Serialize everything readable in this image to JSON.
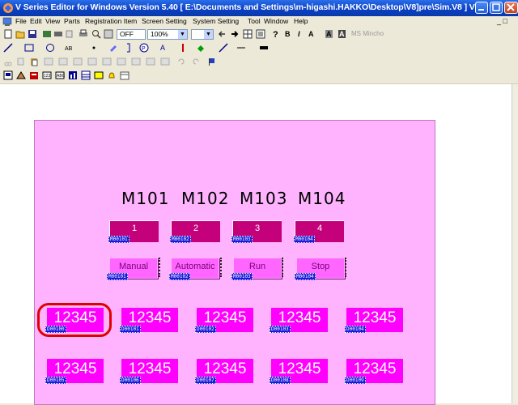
{
  "window": {
    "title": "V Series Editor for Windows Version 5.40 [ E:\\Documents and Settings\\m-higashi.HAKKO\\Desktop\\V8]pre\\Sim.V8 ] V8..."
  },
  "menu": {
    "items": [
      "File",
      "Edit",
      "View",
      "Parts",
      "Registration Item",
      "Screen Setting",
      "System Setting",
      "Tool",
      "Window",
      "Help"
    ]
  },
  "toolbar1": {
    "off_label": "OFF",
    "zoom": "100%",
    "font_name": "MS Mincho",
    "bold": "B",
    "italic": "I",
    "font_a": "A"
  },
  "screen": {
    "background": "#ffb3ff",
    "m_labels": [
      "M101",
      "M102",
      "M103",
      "M104"
    ],
    "lamps": [
      {
        "num": "1",
        "tag": "M00101"
      },
      {
        "num": "2",
        "tag": "M00102"
      },
      {
        "num": "3",
        "tag": "M00103"
      },
      {
        "num": "4",
        "tag": "M00104"
      }
    ],
    "switches": [
      {
        "label": "Manual",
        "tag": "M00101"
      },
      {
        "label": "Automatic",
        "tag": "M00102"
      },
      {
        "label": "Run",
        "tag": "M00103"
      },
      {
        "label": "Stop",
        "tag": "M00104"
      }
    ],
    "num_row1": [
      {
        "value": "12345",
        "tag": "D00100"
      },
      {
        "value": "12345",
        "tag": "D00101"
      },
      {
        "value": "12345",
        "tag": "D00102"
      },
      {
        "value": "12345",
        "tag": "D00103"
      },
      {
        "value": "12345",
        "tag": "D00104"
      }
    ],
    "num_row2": [
      {
        "value": "12345",
        "tag": "D00105"
      },
      {
        "value": "12345",
        "tag": "D00106"
      },
      {
        "value": "12345",
        "tag": "D00107"
      },
      {
        "value": "12345",
        "tag": "D00108"
      },
      {
        "value": "12345",
        "tag": "D00109"
      }
    ]
  },
  "colors": {
    "lamp": "#c4007a",
    "switch": "#ff66ff",
    "numeric": "#ff00ff",
    "highlight": "#e00000",
    "titlebar": "#0a3fc4"
  }
}
